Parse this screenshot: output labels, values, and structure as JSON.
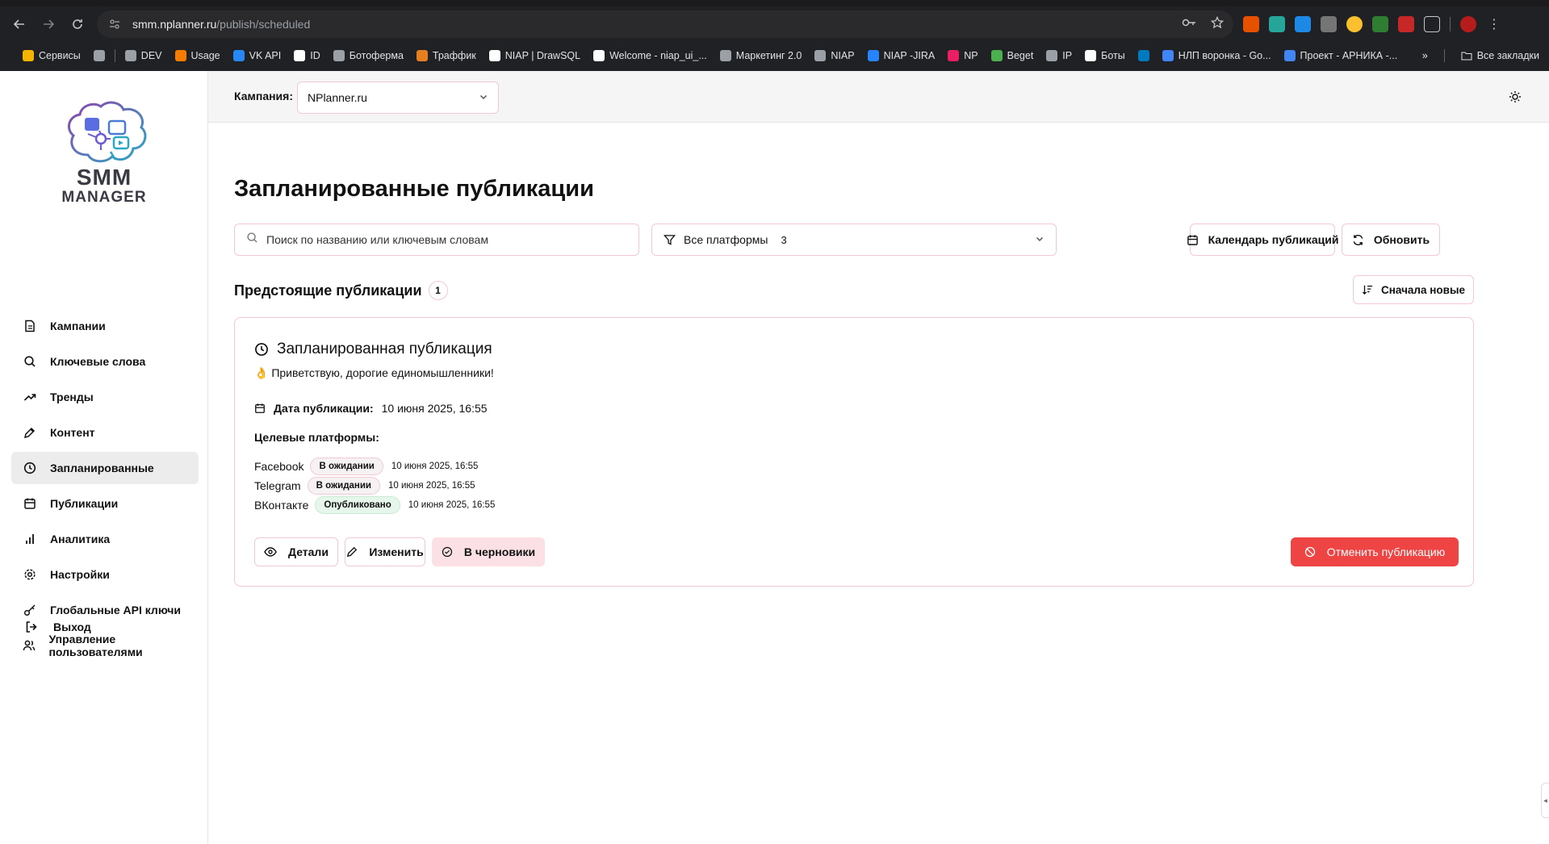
{
  "browser": {
    "url_host": "smm.nplanner.ru",
    "url_path": "/publish/scheduled",
    "bookmarks": [
      {
        "label": "Сервисы",
        "color": "#f4b400"
      },
      {
        "label": "",
        "color": "#9aa0a6"
      },
      {
        "label": "DEV",
        "color": "#9aa0a6"
      },
      {
        "label": "Usage",
        "color": "#f57c00"
      },
      {
        "label": "VK API",
        "color": "#2787f5"
      },
      {
        "label": "ID",
        "color": "#ffffff"
      },
      {
        "label": "Ботоферма",
        "color": "#9aa0a6"
      },
      {
        "label": "Траффик",
        "color": "#e67e22"
      },
      {
        "label": "NIAP | DrawSQL",
        "color": "#ffffff"
      },
      {
        "label": "Welcome - niap_ui_...",
        "color": "#ffffff"
      },
      {
        "label": "Маркетинг 2.0",
        "color": "#9aa0a6"
      },
      {
        "label": "NIAP",
        "color": "#9aa0a6"
      },
      {
        "label": "NIAP -JIRA",
        "color": "#2684ff"
      },
      {
        "label": "NP",
        "color": "#e91e63"
      },
      {
        "label": "Beget",
        "color": "#4caf50"
      },
      {
        "label": "IP",
        "color": "#9aa0a6"
      },
      {
        "label": "Боты",
        "color": "#ffffff"
      },
      {
        "label": "",
        "color": "#0079bf"
      },
      {
        "label": "НЛП воронка - Go...",
        "color": "#4285f4"
      },
      {
        "label": "Проект - АРНИКА -...",
        "color": "#4285f4"
      }
    ],
    "all_bookmarks": "Все закладки"
  },
  "brand": {
    "line1": "SMM",
    "line2": "MANAGER",
    "accent": "#6d5bd0"
  },
  "sidebar": {
    "items": [
      {
        "label": "Кампании",
        "icon": "document-icon",
        "active": false
      },
      {
        "label": "Ключевые слова",
        "icon": "search-icon",
        "active": false
      },
      {
        "label": "Тренды",
        "icon": "trend-icon",
        "active": false
      },
      {
        "label": "Контент",
        "icon": "pen-icon",
        "active": false
      },
      {
        "label": "Запланированные",
        "icon": "clock-icon",
        "active": true
      },
      {
        "label": "Публикации",
        "icon": "calendar-icon",
        "active": false
      },
      {
        "label": "Аналитика",
        "icon": "bar-chart-icon",
        "active": false
      },
      {
        "label": "Настройки",
        "icon": "gear-icon",
        "active": false
      },
      {
        "label": "Глобальные API ключи",
        "icon": "key-icon",
        "active": false
      },
      {
        "label": "Управление пользователями",
        "icon": "users-icon",
        "active": false
      }
    ],
    "logout": "Выход"
  },
  "header": {
    "campaign_label": "Кампания:",
    "campaign_value": "NPlanner.ru"
  },
  "page": {
    "title": "Запланированные публикации",
    "search_placeholder": "Поиск по названию или ключевым словам",
    "filter_label": "Все платформы",
    "filter_count": "3",
    "calendar_button": "Календарь публикаций",
    "refresh_button": "Обновить",
    "section_title": "Предстоящие публикации",
    "section_count": "1",
    "sort_button": "Сначала новые"
  },
  "publication": {
    "title": "Запланированная публикация",
    "excerpt": "👌 Приветствую, дорогие единомышленники!",
    "date_label": "Дата публикации:",
    "date_value": "10 июня 2025, 16:55",
    "targets_label": "Целевые платформы:",
    "platforms": [
      {
        "name": "Facebook",
        "status": "В ожидании",
        "status_type": "pending",
        "date": "10 июня 2025, 16:55"
      },
      {
        "name": "Telegram",
        "status": "В ожидании",
        "status_type": "pending",
        "date": "10 июня 2025, 16:55"
      },
      {
        "name": "ВКонтакте",
        "status": "Опубликовано",
        "status_type": "published",
        "date": "10 июня 2025, 16:55"
      }
    ],
    "actions": {
      "details": "Детали",
      "edit": "Изменить",
      "to_drafts": "В черновики",
      "cancel": "Отменить публикацию"
    }
  },
  "colors": {
    "danger": "#ef4444",
    "active_nav": "#ececec",
    "border_pink": "#f2c9d0"
  }
}
